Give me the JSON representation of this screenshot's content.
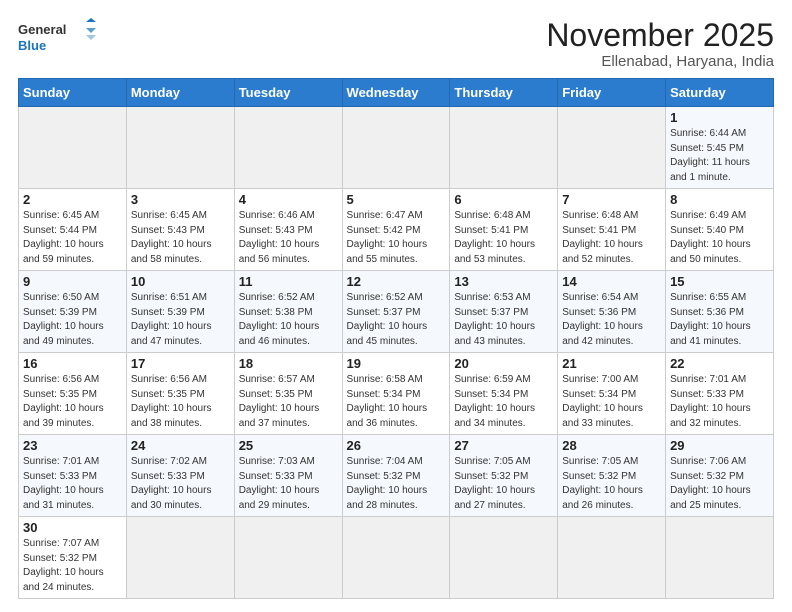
{
  "header": {
    "logo_general": "General",
    "logo_blue": "Blue",
    "month_title": "November 2025",
    "location": "Ellenabad, Haryana, India"
  },
  "weekdays": [
    "Sunday",
    "Monday",
    "Tuesday",
    "Wednesday",
    "Thursday",
    "Friday",
    "Saturday"
  ],
  "weeks": [
    [
      {
        "day": "",
        "info": ""
      },
      {
        "day": "",
        "info": ""
      },
      {
        "day": "",
        "info": ""
      },
      {
        "day": "",
        "info": ""
      },
      {
        "day": "",
        "info": ""
      },
      {
        "day": "",
        "info": ""
      },
      {
        "day": "1",
        "info": "Sunrise: 6:44 AM\nSunset: 5:45 PM\nDaylight: 11 hours and 1 minute."
      }
    ],
    [
      {
        "day": "2",
        "info": "Sunrise: 6:45 AM\nSunset: 5:44 PM\nDaylight: 10 hours and 59 minutes."
      },
      {
        "day": "3",
        "info": "Sunrise: 6:45 AM\nSunset: 5:43 PM\nDaylight: 10 hours and 58 minutes."
      },
      {
        "day": "4",
        "info": "Sunrise: 6:46 AM\nSunset: 5:43 PM\nDaylight: 10 hours and 56 minutes."
      },
      {
        "day": "5",
        "info": "Sunrise: 6:47 AM\nSunset: 5:42 PM\nDaylight: 10 hours and 55 minutes."
      },
      {
        "day": "6",
        "info": "Sunrise: 6:48 AM\nSunset: 5:41 PM\nDaylight: 10 hours and 53 minutes."
      },
      {
        "day": "7",
        "info": "Sunrise: 6:48 AM\nSunset: 5:41 PM\nDaylight: 10 hours and 52 minutes."
      },
      {
        "day": "8",
        "info": "Sunrise: 6:49 AM\nSunset: 5:40 PM\nDaylight: 10 hours and 50 minutes."
      }
    ],
    [
      {
        "day": "9",
        "info": "Sunrise: 6:50 AM\nSunset: 5:39 PM\nDaylight: 10 hours and 49 minutes."
      },
      {
        "day": "10",
        "info": "Sunrise: 6:51 AM\nSunset: 5:39 PM\nDaylight: 10 hours and 47 minutes."
      },
      {
        "day": "11",
        "info": "Sunrise: 6:52 AM\nSunset: 5:38 PM\nDaylight: 10 hours and 46 minutes."
      },
      {
        "day": "12",
        "info": "Sunrise: 6:52 AM\nSunset: 5:37 PM\nDaylight: 10 hours and 45 minutes."
      },
      {
        "day": "13",
        "info": "Sunrise: 6:53 AM\nSunset: 5:37 PM\nDaylight: 10 hours and 43 minutes."
      },
      {
        "day": "14",
        "info": "Sunrise: 6:54 AM\nSunset: 5:36 PM\nDaylight: 10 hours and 42 minutes."
      },
      {
        "day": "15",
        "info": "Sunrise: 6:55 AM\nSunset: 5:36 PM\nDaylight: 10 hours and 41 minutes."
      }
    ],
    [
      {
        "day": "16",
        "info": "Sunrise: 6:56 AM\nSunset: 5:35 PM\nDaylight: 10 hours and 39 minutes."
      },
      {
        "day": "17",
        "info": "Sunrise: 6:56 AM\nSunset: 5:35 PM\nDaylight: 10 hours and 38 minutes."
      },
      {
        "day": "18",
        "info": "Sunrise: 6:57 AM\nSunset: 5:35 PM\nDaylight: 10 hours and 37 minutes."
      },
      {
        "day": "19",
        "info": "Sunrise: 6:58 AM\nSunset: 5:34 PM\nDaylight: 10 hours and 36 minutes."
      },
      {
        "day": "20",
        "info": "Sunrise: 6:59 AM\nSunset: 5:34 PM\nDaylight: 10 hours and 34 minutes."
      },
      {
        "day": "21",
        "info": "Sunrise: 7:00 AM\nSunset: 5:34 PM\nDaylight: 10 hours and 33 minutes."
      },
      {
        "day": "22",
        "info": "Sunrise: 7:01 AM\nSunset: 5:33 PM\nDaylight: 10 hours and 32 minutes."
      }
    ],
    [
      {
        "day": "23",
        "info": "Sunrise: 7:01 AM\nSunset: 5:33 PM\nDaylight: 10 hours and 31 minutes."
      },
      {
        "day": "24",
        "info": "Sunrise: 7:02 AM\nSunset: 5:33 PM\nDaylight: 10 hours and 30 minutes."
      },
      {
        "day": "25",
        "info": "Sunrise: 7:03 AM\nSunset: 5:33 PM\nDaylight: 10 hours and 29 minutes."
      },
      {
        "day": "26",
        "info": "Sunrise: 7:04 AM\nSunset: 5:32 PM\nDaylight: 10 hours and 28 minutes."
      },
      {
        "day": "27",
        "info": "Sunrise: 7:05 AM\nSunset: 5:32 PM\nDaylight: 10 hours and 27 minutes."
      },
      {
        "day": "28",
        "info": "Sunrise: 7:05 AM\nSunset: 5:32 PM\nDaylight: 10 hours and 26 minutes."
      },
      {
        "day": "29",
        "info": "Sunrise: 7:06 AM\nSunset: 5:32 PM\nDaylight: 10 hours and 25 minutes."
      }
    ],
    [
      {
        "day": "30",
        "info": "Sunrise: 7:07 AM\nSunset: 5:32 PM\nDaylight: 10 hours and 24 minutes."
      },
      {
        "day": "",
        "info": ""
      },
      {
        "day": "",
        "info": ""
      },
      {
        "day": "",
        "info": ""
      },
      {
        "day": "",
        "info": ""
      },
      {
        "day": "",
        "info": ""
      },
      {
        "day": "",
        "info": ""
      }
    ]
  ]
}
